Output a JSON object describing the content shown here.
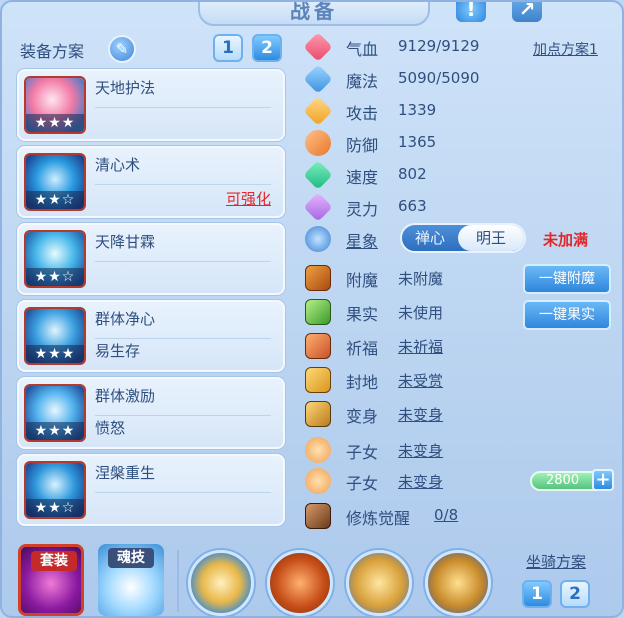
{
  "window": {
    "title": "战备"
  },
  "equip": {
    "label": "装备方案",
    "plan_buttons": [
      "1",
      "2"
    ],
    "active_plan": "2"
  },
  "skills": [
    {
      "name": "天地护法",
      "sub": "",
      "stars": "★★★",
      "action": ""
    },
    {
      "name": "清心术",
      "sub": "",
      "stars": "★★☆",
      "action": "可强化"
    },
    {
      "name": "天降甘霖",
      "sub": "",
      "stars": "★★☆",
      "action": ""
    },
    {
      "name": "群体净心",
      "sub": "易生存",
      "stars": "★★★",
      "action": ""
    },
    {
      "name": "群体激励",
      "sub": "愤怒",
      "stars": "★★★",
      "action": ""
    },
    {
      "name": "涅槃重生",
      "sub": "",
      "stars": "★★☆",
      "action": ""
    }
  ],
  "stats": {
    "plan_link": "加点方案1",
    "rows": [
      {
        "label": "气血",
        "value": "9129/9129",
        "icon": "heart-icon"
      },
      {
        "label": "魔法",
        "value": "5090/5090",
        "icon": "mana-icon"
      },
      {
        "label": "攻击",
        "value": "1339",
        "icon": "sword-icon"
      },
      {
        "label": "防御",
        "value": "1365",
        "icon": "shield-icon"
      },
      {
        "label": "速度",
        "value": "802",
        "icon": "speed-icon"
      },
      {
        "label": "灵力",
        "value": "663",
        "icon": "spirit-icon"
      }
    ]
  },
  "star_sign": {
    "label": "星象",
    "options": [
      "禅心",
      "明王"
    ],
    "selected": "明王",
    "status": "未加满"
  },
  "attrs": [
    {
      "label": "附魔",
      "value": "未附魔",
      "underline": false
    },
    {
      "label": "果实",
      "value": "未使用",
      "underline": false
    },
    {
      "label": "祈福",
      "value": "未祈福",
      "underline": true
    },
    {
      "label": "封地",
      "value": "未受赏",
      "underline": true
    },
    {
      "label": "变身",
      "value": "未变身",
      "underline": true
    },
    {
      "label": "子女",
      "value": "未变身",
      "underline": true
    },
    {
      "label": "子女",
      "value": "未变身",
      "underline": true
    },
    {
      "label": "修炼觉醒",
      "value": "0/8",
      "underline": true
    }
  ],
  "actions": {
    "enchant": "一键附魔",
    "fruit": "一键果实"
  },
  "gauge": {
    "value": "2800",
    "plus": "+"
  },
  "bottom": {
    "set_label": "套装",
    "soul_label": "魂技",
    "mount_label": "坐骑方案",
    "mount_buttons": [
      "1",
      "2"
    ],
    "active_mount": "1"
  },
  "colors": {
    "accent": "#2f8be0",
    "warning": "#e0282a",
    "text": "#2f4f7f"
  }
}
